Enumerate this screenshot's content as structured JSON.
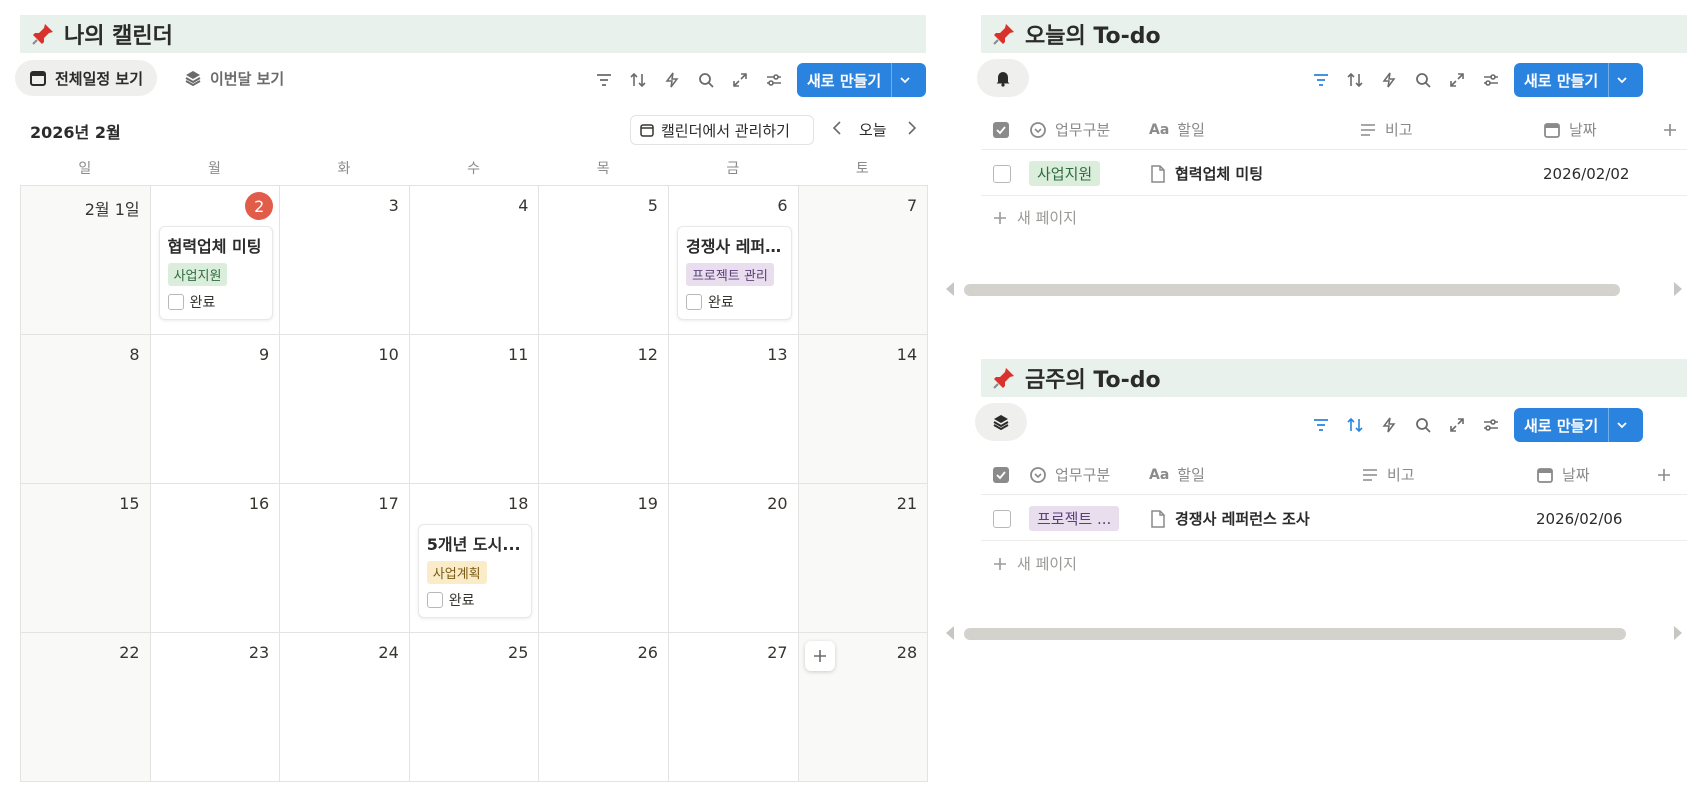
{
  "calendar": {
    "title": "나의 캘린더",
    "tabs": [
      {
        "label": "전체일정 보기",
        "icon": "calendar-icon",
        "active": true
      },
      {
        "label": "이번달 보기",
        "icon": "layers-icon",
        "active": false
      }
    ],
    "new_button": "새로 만들기",
    "month_label": "2026년 2월",
    "manage_button": "캘린더에서 관리하기",
    "today_button": "오늘",
    "weekdays": [
      "일",
      "월",
      "화",
      "수",
      "목",
      "금",
      "토"
    ],
    "days": [
      "2월 1일",
      "2",
      "3",
      "4",
      "5",
      "6",
      "7",
      "8",
      "9",
      "10",
      "11",
      "12",
      "13",
      "14",
      "15",
      "16",
      "17",
      "18",
      "19",
      "20",
      "21",
      "22",
      "23",
      "24",
      "25",
      "26",
      "27",
      "28"
    ],
    "today_day": "2",
    "events": [
      {
        "title": "협력업체 미팅",
        "tag": "사업지원",
        "tag_bg": "#dbeddb",
        "tag_fg": "#2f6b3f",
        "check_label": "완료"
      },
      {
        "title": "경쟁사 레퍼...",
        "tag": "프로젝트 관리",
        "tag_bg": "#e8deee",
        "tag_fg": "#5e3e7a",
        "check_label": "완료"
      },
      {
        "title": "5개년 도시...",
        "tag": "사업계획",
        "tag_bg": "#fbecc9",
        "tag_fg": "#7a5a14",
        "check_label": "완료"
      }
    ]
  },
  "today_todo": {
    "title": "오늘의 To-do",
    "new_button": "새로 만들기",
    "columns": [
      "업무구분",
      "할일",
      "비고",
      "날짜"
    ],
    "rows": [
      {
        "category": "사업지원",
        "cat_bg": "#dbeddb",
        "cat_fg": "#2f6b3f",
        "task": "협력업체 미팅",
        "note": "",
        "date": "2026/02/02"
      }
    ],
    "new_page": "새 페이지"
  },
  "week_todo": {
    "title": "금주의 To-do",
    "new_button": "새로 만들기",
    "columns": [
      "업무구분",
      "할일",
      "비고",
      "날짜"
    ],
    "rows": [
      {
        "category": "프로젝트 ...",
        "cat_bg": "#e8deee",
        "cat_fg": "#5e3e7a",
        "task": "경쟁사 레퍼런스 조사",
        "note": "",
        "date": "2026/02/06"
      }
    ],
    "new_page": "새 페이지"
  },
  "colors": {
    "accent": "#2a83de",
    "section_bg": "#e9f1ec",
    "today_red": "#e25c4a"
  }
}
